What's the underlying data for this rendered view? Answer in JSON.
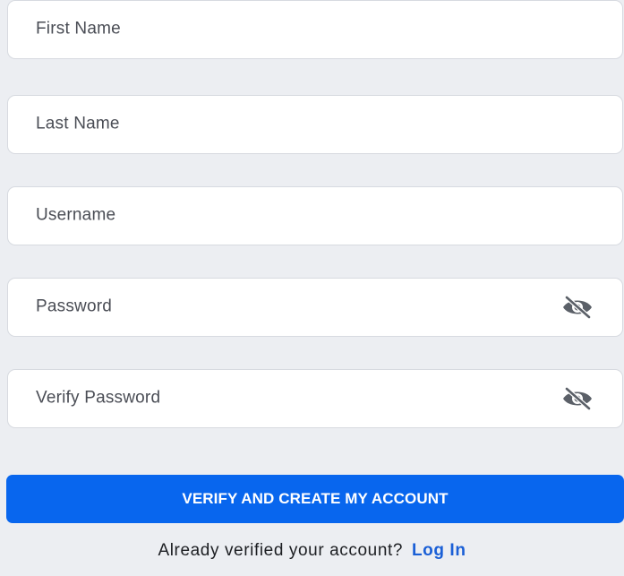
{
  "form": {
    "first_name": {
      "placeholder": "First Name",
      "value": ""
    },
    "last_name": {
      "placeholder": "Last Name",
      "value": ""
    },
    "username": {
      "placeholder": "Username",
      "value": ""
    },
    "password": {
      "placeholder": "Password",
      "value": "",
      "visibility_icon": "eye-off-icon"
    },
    "verify_password": {
      "placeholder": "Verify Password",
      "value": "",
      "visibility_icon": "eye-off-icon"
    }
  },
  "submit": {
    "label": "VERIFY AND CREATE MY ACCOUNT"
  },
  "footer": {
    "prompt": "Already verified your account?",
    "login_link": "Log In"
  },
  "colors": {
    "background": "#eceef2",
    "field_bg": "#ffffff",
    "primary": "#0866ee",
    "link": "#1a5fd6",
    "icon": "#5b6068"
  }
}
